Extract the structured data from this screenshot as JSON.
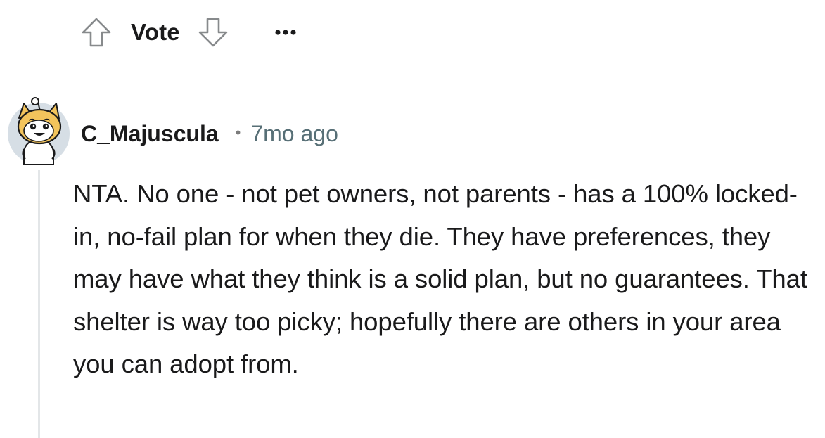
{
  "vote_bar": {
    "upvote_icon": "arrow-up-outline-icon",
    "label": "Vote",
    "downvote_icon": "arrow-down-outline-icon",
    "more_icon": "ellipsis-horizontal-icon"
  },
  "comment": {
    "avatar_icon": "snoo-avatar-icon",
    "author": "C_Majuscula",
    "separator": "•",
    "timestamp": "7mo ago",
    "body": "NTA. No one - not pet owners, not parents - has a 100% locked-in, no-fail plan for when they die. They have preferences, they may have what they think is a solid plan, but no guarantees. That shelter is way too picky; hopefully there are others in your area you can adopt from."
  },
  "colors": {
    "text": "#1a1a1b",
    "meta": "#576f76",
    "icon_outline": "#878a8c",
    "thread_line": "#e3e6e8",
    "avatar_bg": "#d6dee5"
  }
}
